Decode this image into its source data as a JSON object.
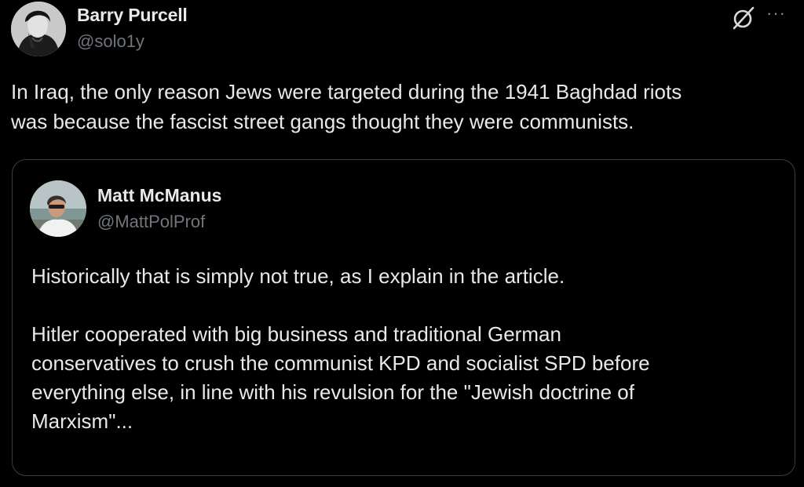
{
  "tweet": {
    "author": {
      "display_name": "Barry Purcell",
      "handle": "@solo1y"
    },
    "text": "In Iraq, the only reason Jews were targeted during the 1941 Baghdad riots\nwas because the fascist street gangs thought they were communists.",
    "actions": {
      "grok_icon": "grok-icon",
      "more_icon": "more-icon",
      "more_symbol": "···"
    }
  },
  "quote": {
    "author": {
      "display_name": "Matt McManus",
      "handle": "@MattPolProf"
    },
    "text": "Historically that is simply not true, as I explain in the article.\n\nHitler cooperated with big business and traditional German\nconservatives to crush the communist KPD and socialist SPD before\neverything else, in line with his revulsion for the \"Jewish doctrine of\nMarxism\"..."
  },
  "colors": {
    "background": "#000000",
    "text_primary": "#e7e9ea",
    "text_secondary": "#71767b",
    "border": "#3a3d41"
  }
}
